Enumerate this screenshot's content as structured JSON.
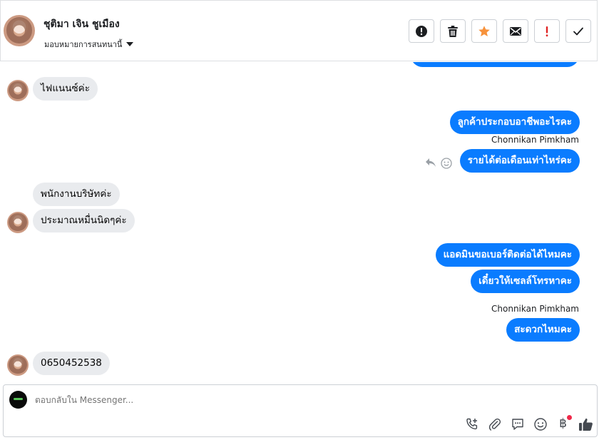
{
  "header": {
    "contact_name": "ชุติมา เจิน ชูเมือง",
    "assign_label": "มอบหมายการสนทนานี้"
  },
  "toolbar": {
    "buttons": [
      {
        "name": "mark-spam-button",
        "icon": "exclamation-circle-icon"
      },
      {
        "name": "delete-button",
        "icon": "trash-icon"
      },
      {
        "name": "star-button",
        "icon": "star-icon",
        "color": "#f7923b"
      },
      {
        "name": "mark-unread-button",
        "icon": "envelope-icon"
      },
      {
        "name": "follow-up-button",
        "icon": "exclamation-icon",
        "color": "#e02424"
      },
      {
        "name": "mark-done-button",
        "icon": "check-icon"
      }
    ]
  },
  "messages": [
    {
      "id": "m1",
      "direction": "incoming",
      "text": "ไฟแนนซ์ค่ะ"
    },
    {
      "id": "m2",
      "direction": "outgoing",
      "text": "ลูกค้าประกอบอาชีพอะไรคะ"
    },
    {
      "id": "m3",
      "direction": "outgoing",
      "sender": "Chonnikan Pimkham",
      "text": "รายได้ต่อเดือนเท่าไหร่คะ"
    },
    {
      "id": "m4",
      "direction": "incoming",
      "text": "พนักงานบริษัทค่ะ"
    },
    {
      "id": "m5",
      "direction": "incoming",
      "text": "ประมาณหมื่นนิดๆค่ะ"
    },
    {
      "id": "m6",
      "direction": "outgoing",
      "text": "แอดมินขอเบอร์ติดต่อได้ไหมคะ"
    },
    {
      "id": "m7",
      "direction": "outgoing",
      "text": "เดี๋ยวให้เซลล์โทรหาคะ"
    },
    {
      "id": "m8",
      "direction": "outgoing",
      "sender": "Chonnikan Pimkham",
      "text": "สะดวกไหมคะ"
    },
    {
      "id": "m9",
      "direction": "incoming",
      "text": "0650452538"
    }
  ],
  "composer": {
    "placeholder": "ตอบกลับใน Messenger...",
    "icons": [
      "phone-add-icon",
      "paperclip-icon",
      "saved-reply-icon",
      "emoji-icon",
      "baht-payment-icon",
      "like-thumb-icon"
    ],
    "accent": "#0a7cff"
  }
}
